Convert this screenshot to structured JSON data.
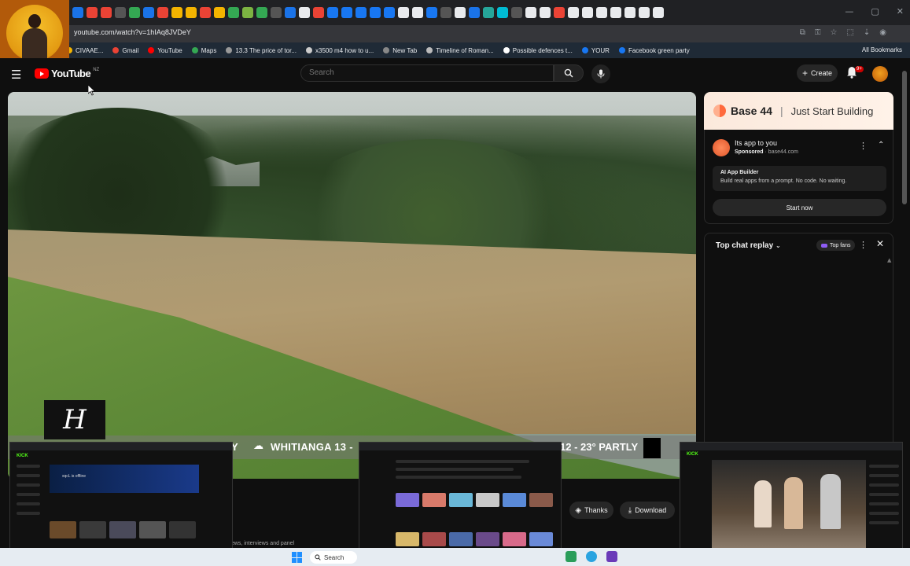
{
  "browser": {
    "url": "youtube.com/watch?v=1hIAq8JVDeY",
    "bookmarks": [
      {
        "label": "CIVAAE...",
        "color": "#f4b400"
      },
      {
        "label": "Gmail",
        "color": "#ea4335"
      },
      {
        "label": "YouTube",
        "color": "#ff0000"
      },
      {
        "label": "Maps",
        "color": "#34a853"
      },
      {
        "label": "13.3 The price of tor...",
        "color": "#999999"
      },
      {
        "label": "x3500 m4 how to u...",
        "color": "#cccccc"
      },
      {
        "label": "New Tab",
        "color": "#888888"
      },
      {
        "label": "Timeline of Roman...",
        "color": "#bbbbbb"
      },
      {
        "label": "Possible defences t...",
        "color": "#ffffff"
      },
      {
        "label": "YOUR",
        "color": "#1877f2"
      },
      {
        "label": "Facebook green party",
        "color": "#1877f2"
      }
    ],
    "all_bookmarks": "All Bookmarks",
    "tab_favicon_colors": [
      "#1a73e8",
      "#ea4335",
      "#ea4335",
      "#555555",
      "#34a853",
      "#1a73e8",
      "#ea4335",
      "#f4b400",
      "#f4b400",
      "#ea4335",
      "#f4b400",
      "#34a853",
      "#7cb342",
      "#34a853",
      "#555555",
      "#1a73e8",
      "#e8eaed",
      "#ea4335",
      "#1877f2",
      "#1877f2",
      "#1877f2",
      "#1877f2",
      "#1877f2",
      "#e8eaed",
      "#e8eaed",
      "#1877f2",
      "#555555",
      "#e8eaed",
      "#1a73e8",
      "#26a69a",
      "#00bcd4",
      "#555555",
      "#e8eaed",
      "#e8eaed",
      "#ea4335",
      "#e8eaed",
      "#e8eaed",
      "#e8eaed",
      "#e8eaed",
      "#e8eaed",
      "#e8eaed",
      "#e8eaed"
    ]
  },
  "youtube": {
    "logo": "YouTube",
    "region": "NZ",
    "search_placeholder": "Search",
    "create_label": "Create",
    "notification_count": "9+"
  },
  "video": {
    "ticker_left": "WHITIANGA 13 -",
    "ticker_right": "12 - 23° PARTLY",
    "ticker_prefix": "Y",
    "logo_letter": "H"
  },
  "actions": {
    "thanks": "Thanks",
    "download": "Download",
    "description_snippet": "news, interviews and panel"
  },
  "ad": {
    "brand": "Base 44",
    "tagline": "Just Start Building",
    "title": "Its app to you",
    "sponsored": "Sponsored",
    "domain": "base44.com",
    "inner_title": "AI App Builder",
    "inner_desc": "Build real apps from a prompt. No code. No waiting.",
    "cta": "Start now"
  },
  "chat": {
    "title": "Top chat replay",
    "badge": "Top fans"
  },
  "taskbar": {
    "search_label": "Search"
  },
  "overlays": {
    "kick_label": "KICK",
    "thumb1_caption": "xqcL is offline"
  }
}
